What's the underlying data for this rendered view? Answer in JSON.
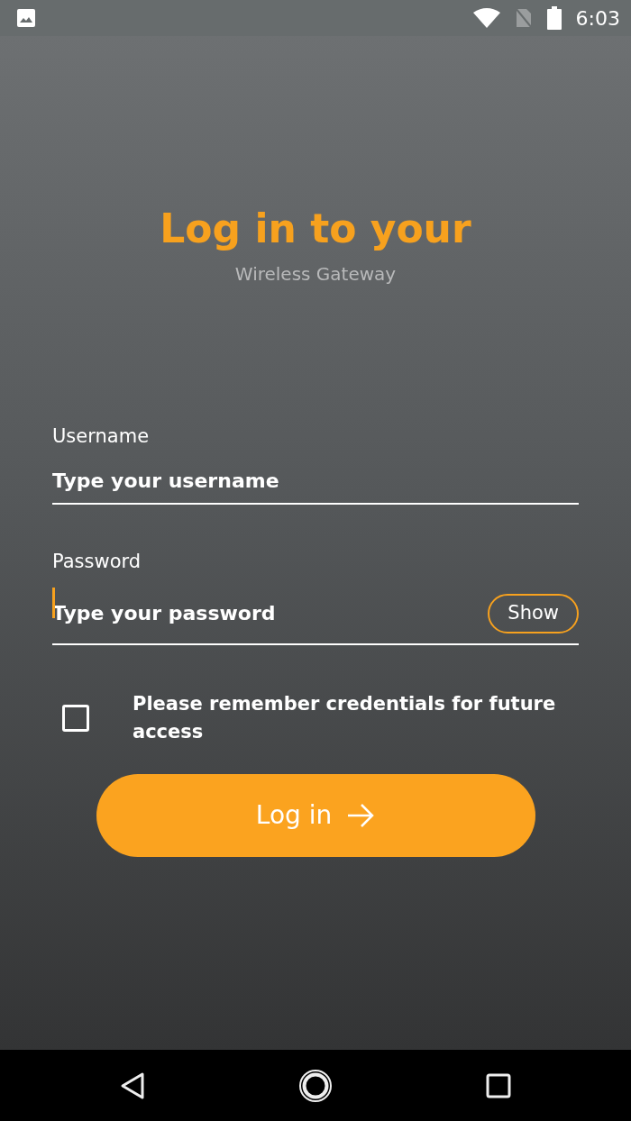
{
  "status_bar": {
    "time": "6:03"
  },
  "title": "Log in to your",
  "subtitle": "Wireless Gateway",
  "fields": [
    {
      "label": "Username",
      "placeholder": "Type your username",
      "focused": false
    },
    {
      "label": "Password",
      "placeholder": "Type your password",
      "focused": true,
      "button": "Show"
    }
  ],
  "remember": {
    "label": "Please remember credentials for future access",
    "checked": false
  },
  "login_button": "Log in"
}
